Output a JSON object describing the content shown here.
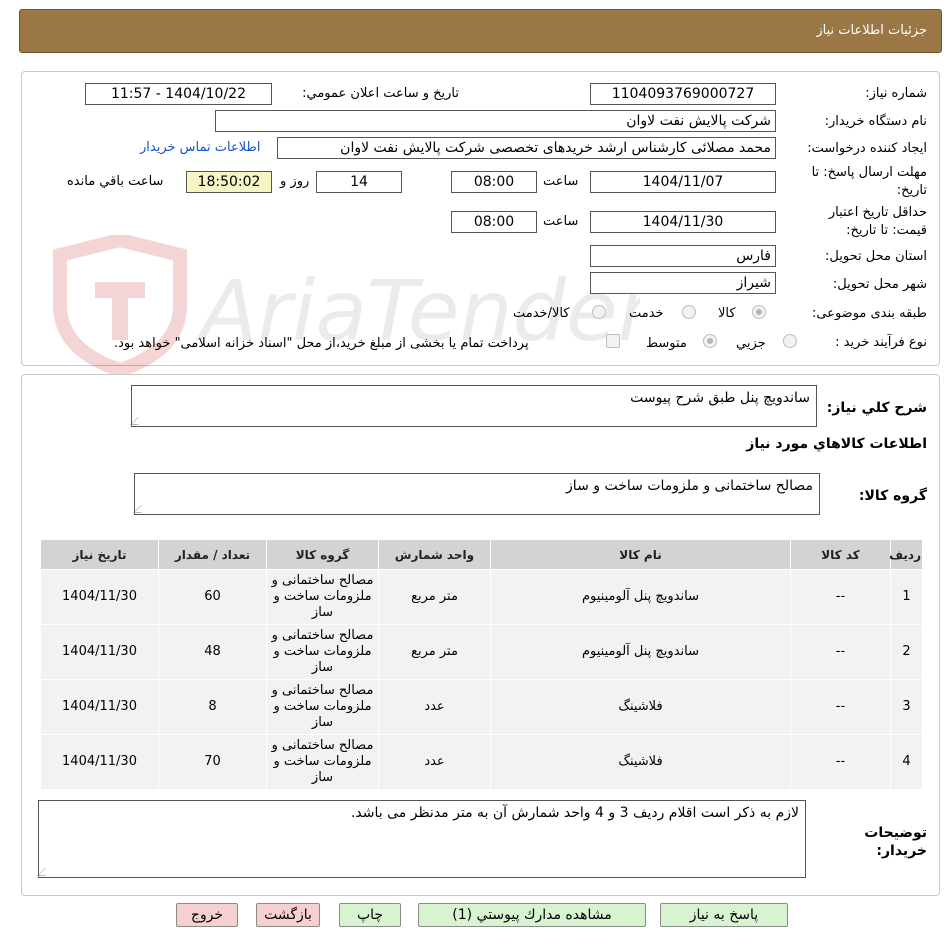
{
  "header": {
    "title": "جزئیات اطلاعات نیاز"
  },
  "form": {
    "need_number_label": "شماره نیاز:",
    "need_number": "1104093769000727",
    "announce_label": "تاریخ و ساعت اعلان عمومي:",
    "announce_value": "1404/10/22 - 11:57",
    "buyer_org_label": "نام دستگاه خريدار:",
    "buyer_org": "شرکت پالایش نفت لاوان",
    "requester_label": "ايجاد کننده درخواست:",
    "requester": "محمد مصلائی کارشناس ارشد خریدهای تخصصی شرکت پالایش نفت لاوان",
    "contact_link": "اطلاعات تماس خريدار",
    "deadline_label": "مهلت ارسال پاسخ: تا تاريخ:",
    "deadline_date": "1404/11/07",
    "time_label": "ساعت",
    "deadline_time": "08:00",
    "days_value": "14",
    "days_label": "روز و",
    "remaining_time": "18:50:02",
    "remaining_label": "ساعت باقي مانده",
    "validity_label": "حداقل تاريخ اعتبار قيمت: تا تاريخ:",
    "validity_date": "1404/11/30",
    "validity_time": "08:00",
    "province_label": "استان محل تحويل:",
    "province": "فارس",
    "city_label": "شهر محل تحويل:",
    "city": "شیراز",
    "category_label": "طبقه بندی موضوعی:",
    "category_options": [
      "کالا",
      "خدمت",
      "کالا/خدمت"
    ],
    "process_label": "نوع فرآيند خريد :",
    "process_options": [
      "جزيي",
      "متوسط"
    ],
    "payment_note": "پرداخت تمام يا بخشی از مبلغ خريد،از محل \"اسناد خزانه اسلامی\" خواهد بود."
  },
  "summary": {
    "label": "شرح کلي نياز:",
    "value": "ساندویچ پنل طبق شرح پیوست",
    "goods_title": "اطلاعات کالاهاي مورد نياز",
    "group_label": "گروه کالا:",
    "group_value": "مصالح ساختمانی و ملزومات ساخت و ساز"
  },
  "table": {
    "headers": [
      "رديف",
      "کد کالا",
      "نام کالا",
      "واحد شمارش",
      "گروه کالا",
      "تعداد / مقدار",
      "تاريخ نياز"
    ],
    "rows": [
      [
        "1",
        "--",
        "ساندویچ پنل آلومینیوم",
        "متر مربع",
        "مصالح ساختمانی و ملزومات ساخت و ساز",
        "60",
        "1404/11/30"
      ],
      [
        "2",
        "--",
        "ساندویچ پنل آلومینیوم",
        "متر مربع",
        "مصالح ساختمانی و ملزومات ساخت و ساز",
        "48",
        "1404/11/30"
      ],
      [
        "3",
        "--",
        "فلاشینگ",
        "عدد",
        "مصالح ساختمانی و ملزومات ساخت و ساز",
        "8",
        "1404/11/30"
      ],
      [
        "4",
        "--",
        "فلاشینگ",
        "عدد",
        "مصالح ساختمانی و ملزومات ساخت و ساز",
        "70",
        "1404/11/30"
      ]
    ]
  },
  "notes": {
    "label": "توضيحات خريدار:",
    "value": "لازم به ذکر است اقلام ردیف 3 و 4 واحد شمارش آن به متر مدنظر می باشد."
  },
  "buttons": {
    "reply": "پاسخ به نياز",
    "attachments": "مشاهده مدارك پيوستي (1)",
    "print": "چاپ",
    "back": "بازگشت",
    "exit": "خروج"
  },
  "colors": {
    "header_bg": "#9b7745",
    "button_green": "#d8f3d0",
    "button_red": "#f7d1d1"
  },
  "watermark": {
    "text": "AriaTender.net"
  }
}
